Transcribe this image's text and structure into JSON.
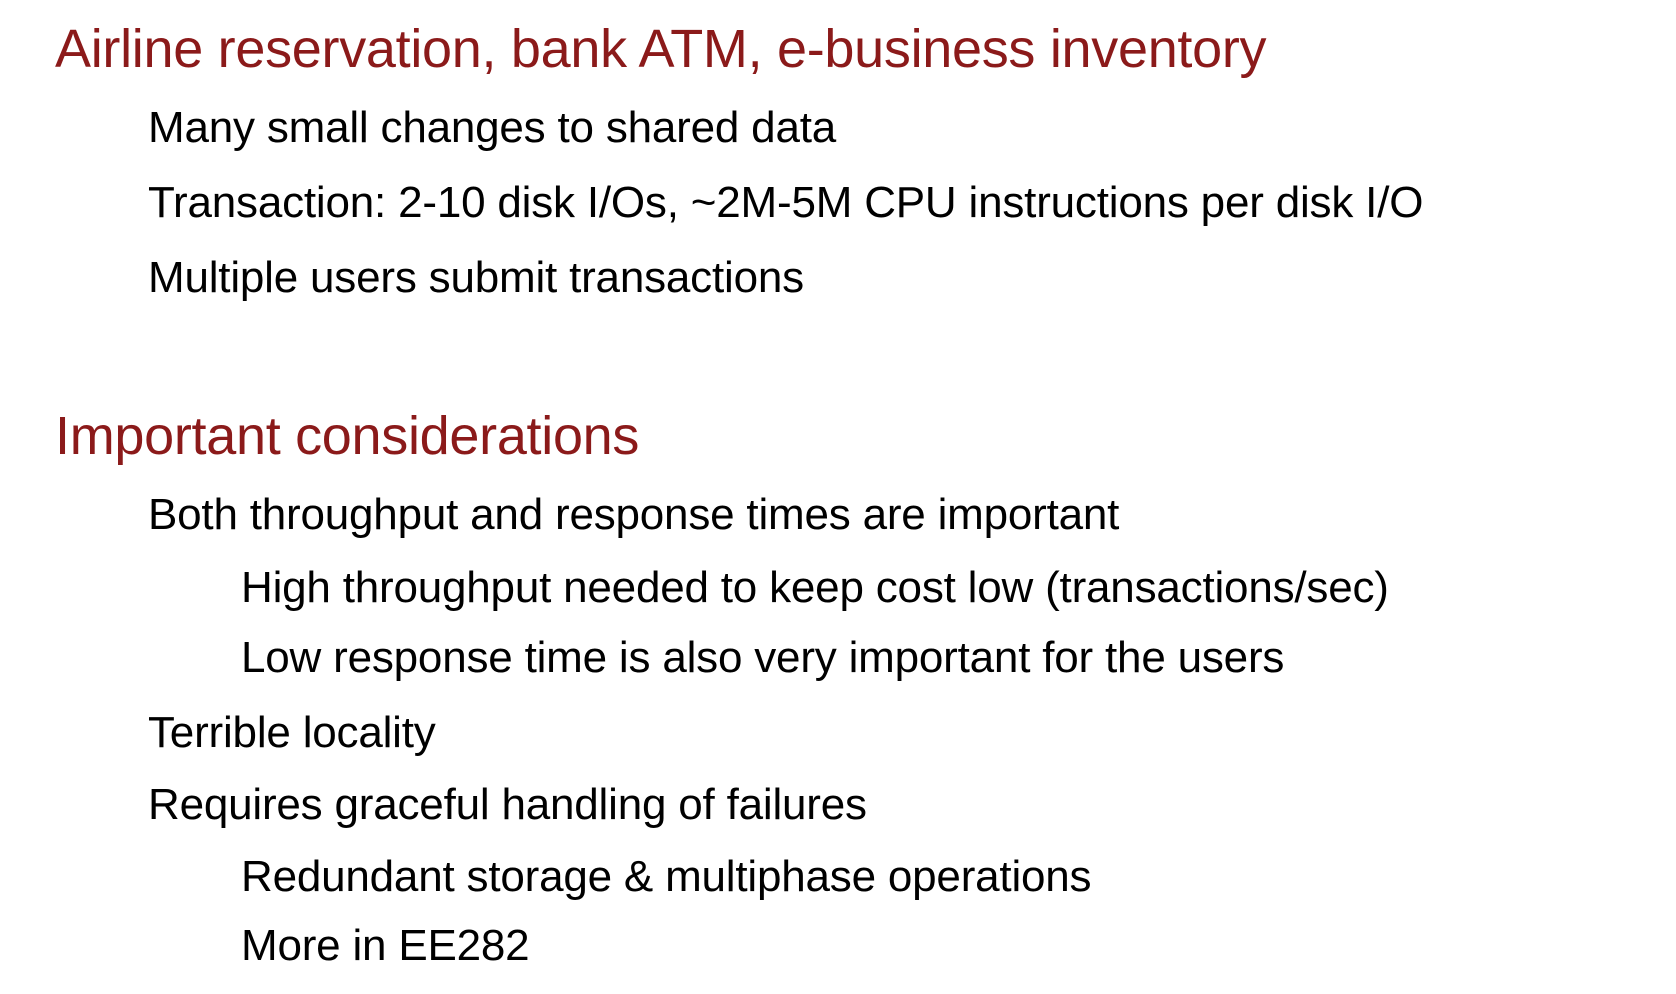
{
  "accent_color": "#8b1a1a",
  "text_color": "#000000",
  "sections": [
    {
      "heading": "Airline reservation, bank ATM, e-business inventory",
      "items": [
        "Many small changes to shared data",
        "Transaction: 2-10 disk I/Os, ~2M-5M CPU instructions per disk I/O",
        "Multiple users submit transactions"
      ]
    },
    {
      "heading": "Important considerations",
      "items": [
        "Both throughput and response times are important",
        "High throughput needed to keep cost low (transactions/sec)",
        "Low response time is also very important for the users",
        "Terrible locality",
        "Requires graceful handling of failures",
        "Redundant storage & multiphase operations",
        "More in EE282"
      ]
    }
  ]
}
